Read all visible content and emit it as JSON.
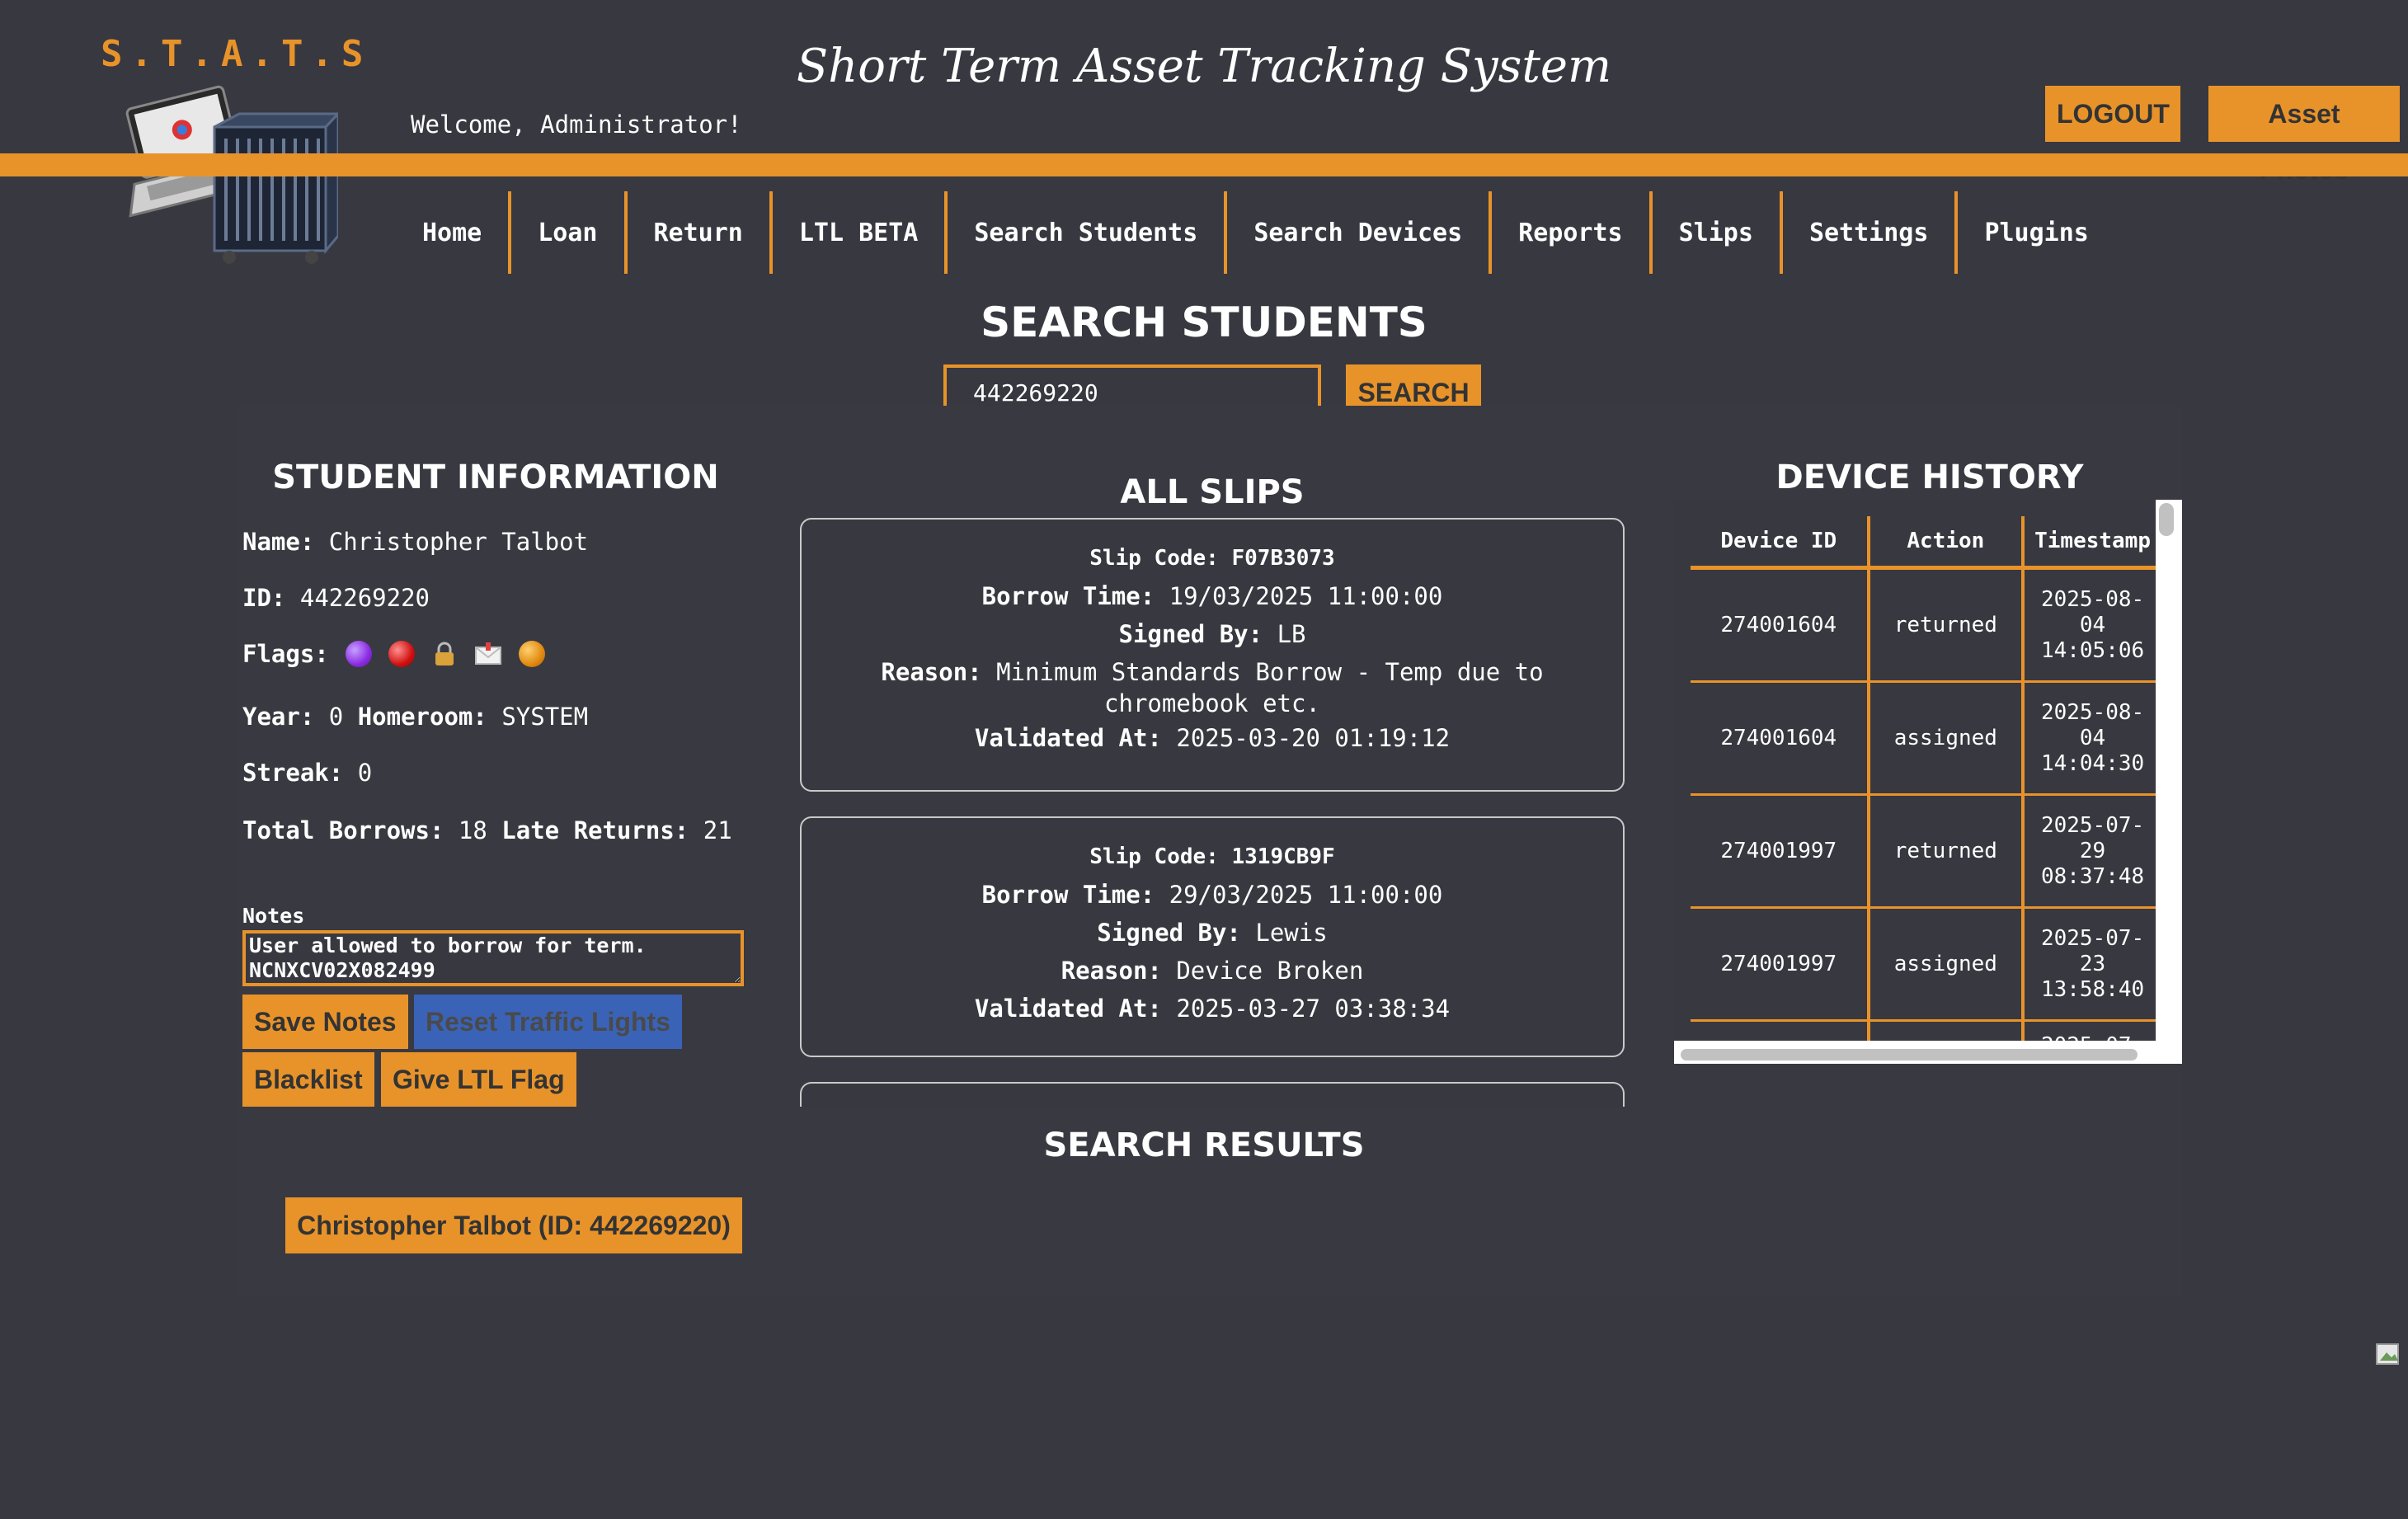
{
  "header": {
    "logo_text": "S.T.A.T.S",
    "title": "Short Term Asset Tracking System",
    "welcome": "Welcome, Administrator!",
    "logout_label": "LOGOUT",
    "photos_label": "Asset Photos",
    "accent_color": "#e8932a"
  },
  "nav": {
    "items": [
      "Home",
      "Loan",
      "Return",
      "LTL BETA",
      "Search Students",
      "Search Devices",
      "Reports",
      "Slips",
      "Settings",
      "Plugins"
    ]
  },
  "search": {
    "heading": "SEARCH STUDENTS",
    "value": "442269220",
    "button": "SEARCH"
  },
  "student": {
    "heading": "STUDENT INFORMATION",
    "name_label": "Name:",
    "name": "Christopher Talbot",
    "id_label": "ID:",
    "id": "442269220",
    "flags_label": "Flags:",
    "flags": [
      "purple-circle-icon",
      "red-circle-icon",
      "lock-icon",
      "envelope-icon",
      "orange-circle-icon"
    ],
    "year_label": "Year:",
    "year": "0",
    "homeroom_label": "Homeroom:",
    "homeroom": "SYSTEM",
    "streak_label": "Streak:",
    "streak": "0",
    "total_borrows_label": "Total Borrows:",
    "total_borrows": "18",
    "late_returns_label": "Late Returns:",
    "late_returns": "21",
    "notes_label": "Notes",
    "notes": "User allowed to borrow for term.\nNCNXCV02X082499",
    "buttons": {
      "save_notes": "Save Notes",
      "reset_lights": "Reset Traffic Lights",
      "blacklist": "Blacklist",
      "ltl_flag": "Give LTL Flag"
    }
  },
  "slips": {
    "heading": "ALL SLIPS",
    "labels": {
      "code": "Slip Code:",
      "borrow_time": "Borrow Time:",
      "signed_by": "Signed By:",
      "reason": "Reason:",
      "validated": "Validated At:"
    },
    "items": [
      {
        "code": "F07B3073",
        "borrow_time": "19/03/2025 11:00:00",
        "signed_by": "LB",
        "reason": "Minimum Standards Borrow - Temp due to chromebook etc.",
        "validated": "2025-03-20 01:19:12"
      },
      {
        "code": "1319CB9F",
        "borrow_time": "29/03/2025 11:00:00",
        "signed_by": "Lewis",
        "reason": "Device Broken",
        "validated": "2025-03-27 03:38:34"
      }
    ]
  },
  "device_history": {
    "heading": "DEVICE HISTORY",
    "columns": [
      "Device ID",
      "Action",
      "Timestamp"
    ],
    "rows": [
      [
        "274001604",
        "returned",
        "2025-08-04 14:05:06"
      ],
      [
        "274001604",
        "assigned",
        "2025-08-04 14:04:30"
      ],
      [
        "274001997",
        "returned",
        "2025-07-29 08:37:48"
      ],
      [
        "274001997",
        "assigned",
        "2025-07-23 13:58:40"
      ],
      [
        "",
        "",
        "2025-07-"
      ]
    ]
  },
  "results": {
    "heading": "SEARCH RESULTS",
    "items": [
      "Christopher Talbot (ID: 442269220)"
    ]
  }
}
